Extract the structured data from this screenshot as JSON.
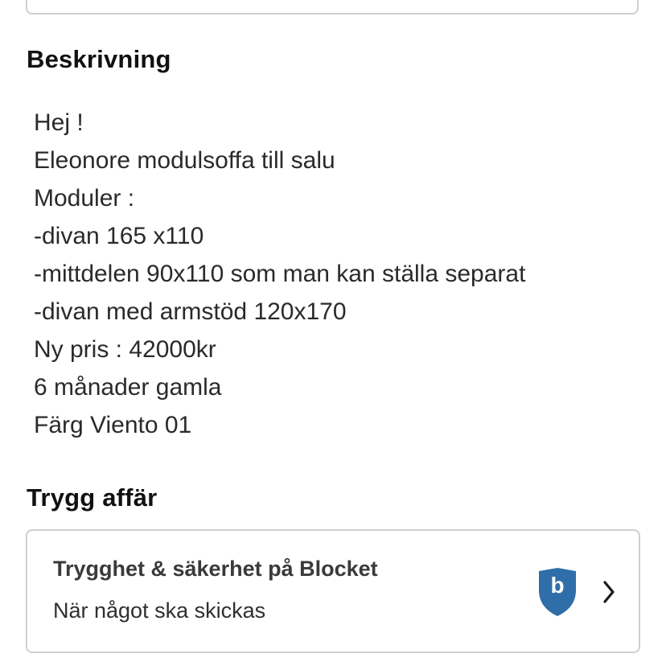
{
  "description_section": {
    "heading": "Beskrivning",
    "lines": [
      "Hej !",
      "Eleonore modulsoffa till salu",
      "Moduler :",
      "-divan 165 x110",
      "-mittdelen 90x110 som man kan ställa separat",
      "-divan med armstöd 120x170",
      "Ny pris : 42000kr",
      "6 månader gamla",
      "Färg Viento 01"
    ]
  },
  "safe_deal_section": {
    "heading": "Trygg affär",
    "card": {
      "title": "Trygghet & säkerhet på Blocket",
      "subtitle": "När något ska skickas",
      "badge_icon": "blocket-shield-icon",
      "badge_letter": "b",
      "badge_color": "#2f6ea8",
      "arrow_icon": "chevron-right-icon"
    }
  }
}
